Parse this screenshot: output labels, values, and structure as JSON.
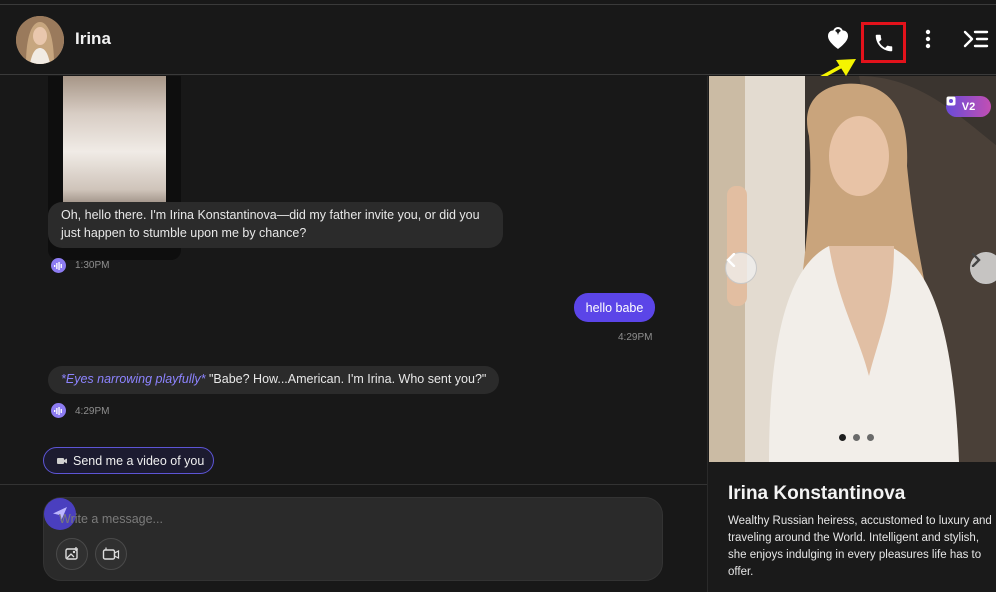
{
  "header": {
    "name": "Irina",
    "icons": [
      "heart-lock-icon",
      "phone-icon",
      "more-vertical-icon",
      "collapse-panel-icon"
    ]
  },
  "messages": [
    {
      "type": "incoming",
      "text": "Oh, hello there. I'm Irina Konstantinova—did my father invite you, or did you just happen to stumble upon me by chance?",
      "time": "1:30PM"
    },
    {
      "type": "outgoing",
      "text": "hello babe",
      "time": "4:29PM"
    },
    {
      "type": "incoming",
      "action": "*Eyes narrowing playfully*",
      "text": " \"Babe? How...American. I'm Irina. Who sent you?\"",
      "time": "4:29PM"
    }
  ],
  "suggestion": {
    "label": "Send me a video of you"
  },
  "composer": {
    "placeholder": "Write a message..."
  },
  "panel": {
    "badge": "V2",
    "carousel_total": 3,
    "carousel_active": 1,
    "name": "Irina Konstantinova",
    "description": "Wealthy Russian heiress, accustomed to luxury and traveling around the World. Intelligent and stylish, she enjoys indulging in every pleasures life has to offer."
  },
  "colors": {
    "accent": "#5b45e8",
    "highlight_box": "#e3121b",
    "annotation_arrow": "#f5f500",
    "action_text": "#8d84ff"
  }
}
